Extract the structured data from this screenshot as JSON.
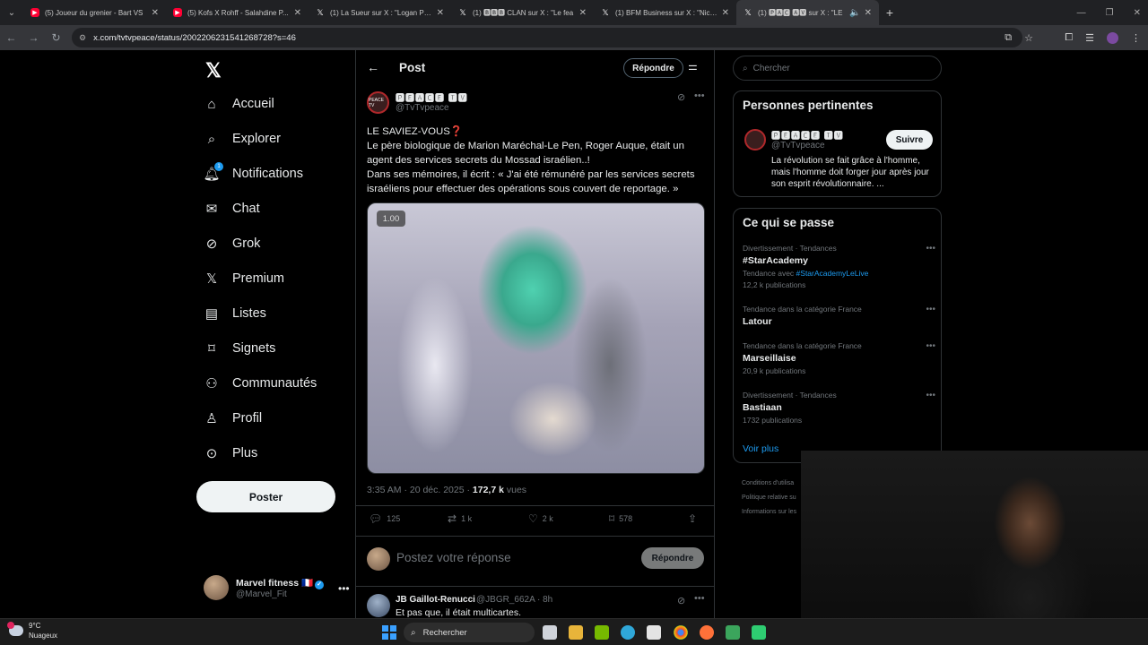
{
  "browser": {
    "tabs": [
      {
        "label": "(5) Joueur du grenier - Bart VS",
        "favicon": "youtube-icon",
        "active": false
      },
      {
        "label": "(5) Kofs X Rohff - Salahdine P...",
        "favicon": "youtube-icon",
        "active": false
      },
      {
        "label": "(1) La Sueur sur X : \"Logan Paul",
        "favicon": "x-icon",
        "active": false
      },
      {
        "label": "(1) 🅱🅱🅱 CLAN sur X : \"Le fea",
        "favicon": "x-icon",
        "active": false
      },
      {
        "label": "(1) BFM Business sur X : \"Nicola",
        "favicon": "x-icon",
        "active": false
      },
      {
        "label": "(1) 🅿🅰🅲 🅰🆅 sur X : \"LE",
        "favicon": "x-icon",
        "active": true
      }
    ],
    "url": "x.com/tvtvpeace/status/2002206231541268728?s=46"
  },
  "sidebar": {
    "items": [
      {
        "label": "Accueil",
        "icon": "home-icon"
      },
      {
        "label": "Explorer",
        "icon": "search-icon"
      },
      {
        "label": "Notifications",
        "icon": "bell-icon",
        "badge": "1"
      },
      {
        "label": "Chat",
        "icon": "mail-icon"
      },
      {
        "label": "Grok",
        "icon": "grok-icon"
      },
      {
        "label": "Premium",
        "icon": "x-logo-icon"
      },
      {
        "label": "Listes",
        "icon": "list-icon"
      },
      {
        "label": "Signets",
        "icon": "bookmark-icon"
      },
      {
        "label": "Communautés",
        "icon": "communities-icon"
      },
      {
        "label": "Profil",
        "icon": "person-icon"
      },
      {
        "label": "Plus",
        "icon": "more-circle-icon"
      }
    ],
    "post_button": "Poster",
    "account": {
      "name": "Marvel fitness 🇫🇷",
      "handle": "@Marvel_Fit"
    }
  },
  "main": {
    "header_title": "Post",
    "reply_button": "Répondre",
    "author": {
      "name": "🅿🅴🅰🅲🅴 🆃🆅",
      "handle": "@TvTvpeace"
    },
    "text_lines": [
      "LE SAVIEZ-VOUS❓",
      "Le père biologique de Marion Maréchal-Le Pen, Roger Auque, était un agent des services secrets du Mossad israélien..!",
      "Dans ses mémoires, il écrit : « J'ai été rémunéré par les services secrets israéliens pour effectuer des opérations sous couvert de reportage. »"
    ],
    "video_speed": "1.00",
    "timestamp": "3:35 AM · 20 déc. 2025 · ",
    "views_count": "172,7 k",
    "views_label": " vues",
    "stats": {
      "replies": "125",
      "reposts": "1 k",
      "likes": "2 k",
      "bookmarks": "578"
    },
    "reply_placeholder": "Postez votre réponse",
    "reply_submit": "Répondre",
    "comment": {
      "name": "JB Gaillot-Renucci",
      "handle": "@JBGR_662A · 8h",
      "text": "Et pas que, il était multicartes."
    }
  },
  "right": {
    "search_placeholder": "Chercher",
    "relevant": {
      "title": "Personnes pertinentes",
      "name": "🅿🅴🅰🅲🅴 🆃🆅",
      "handle": "@TvTvpeace",
      "follow": "Suivre",
      "bio": "La révolution se fait grâce à l'homme, mais l'homme doit forger jour après jour son esprit révolutionnaire. ..."
    },
    "trends": {
      "title": "Ce qui se passe",
      "items": [
        {
          "category": "Divertissement · Tendances",
          "name": "#StarAcademy",
          "with_prefix": "Tendance avec ",
          "with_tag": "#StarAcademyLeLive",
          "count": "12,2 k publications"
        },
        {
          "category": "Tendance dans la catégorie France",
          "name": "Latour",
          "count": ""
        },
        {
          "category": "Tendance dans la catégorie France",
          "name": "Marseillaise",
          "count": "20,9 k publications"
        },
        {
          "category": "Divertissement · Tendances",
          "name": "Bastiaan",
          "count": "1732 publications"
        }
      ],
      "see_more": "Voir plus"
    },
    "footer": [
      "Conditions d'utilisa",
      "Politique relative su",
      "Informations sur les"
    ]
  },
  "taskbar": {
    "weather_temp": "9°C",
    "weather_desc": "Nuageux",
    "search_label": "Rechercher"
  }
}
